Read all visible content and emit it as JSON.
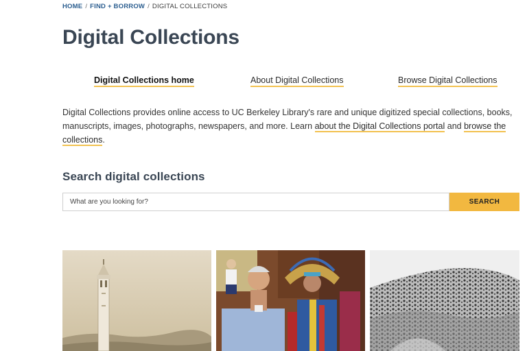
{
  "breadcrumb": {
    "home": "HOME",
    "separator": "/",
    "parent": "FIND + BORROW",
    "current": "DIGITAL COLLECTIONS"
  },
  "page_title": "Digital Collections",
  "subnav": {
    "items": [
      {
        "label": "Digital Collections home",
        "active": true
      },
      {
        "label": "About Digital Collections",
        "active": false
      },
      {
        "label": "Browse Digital Collections",
        "active": false
      }
    ]
  },
  "intro": {
    "text_start": "Digital Collections provides online access to UC Berkeley Library's rare and unique digitized special collections, books, manuscripts, images, photographs, newspapers, and more. Learn ",
    "link_about": "about the Digital Collections portal",
    "text_middle": " and ",
    "link_browse": "browse the collections",
    "text_end": "."
  },
  "search": {
    "heading": "Search digital collections",
    "placeholder": "What are you looking for?",
    "button_label": "SEARCH"
  },
  "thumbnails": [
    {
      "icon": "campanile-tower-photo"
    },
    {
      "icon": "portrait-photo"
    },
    {
      "icon": "hillside-landscape-photo"
    }
  ],
  "colors": {
    "accent_yellow": "#f2b840",
    "underline_yellow": "#f2c14e",
    "heading_slate": "#3a4654",
    "link_blue": "#2a5d8f"
  }
}
